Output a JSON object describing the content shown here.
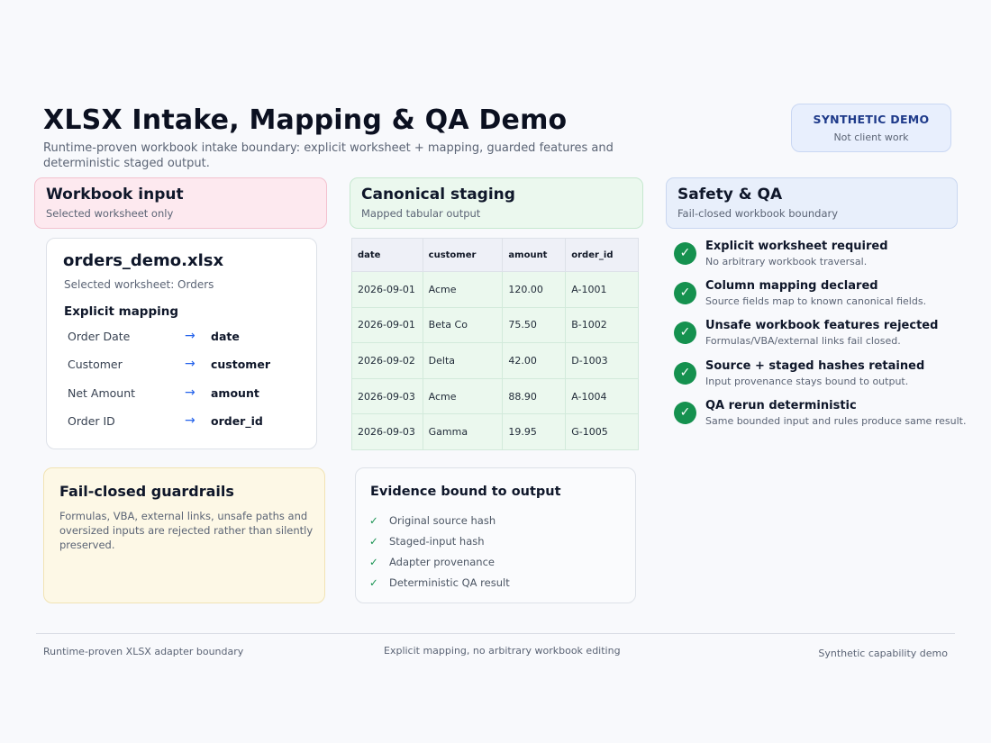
{
  "header": {
    "title": "XLSX Intake, Mapping & QA Demo",
    "subtitle": "Runtime-proven workbook intake boundary: explicit worksheet + mapping, guarded features and deterministic staged output."
  },
  "badge": {
    "title": "SYNTHETIC DEMO",
    "subtitle": "Not client work"
  },
  "columns": {
    "input": {
      "heading": "Workbook input",
      "sub": "Selected worksheet only"
    },
    "staging": {
      "heading": "Canonical staging",
      "sub": "Mapped tabular output"
    },
    "safety": {
      "heading": "Safety & QA",
      "sub": "Fail-closed workbook boundary"
    }
  },
  "file": {
    "name": "orders_demo.xlsx",
    "worksheet": "Selected worksheet: Orders",
    "mapping_heading": "Explicit mapping",
    "arrow_icon": "→",
    "mappings": [
      {
        "source": "Order Date",
        "target": "date"
      },
      {
        "source": "Customer",
        "target": "customer"
      },
      {
        "source": "Net Amount",
        "target": "amount"
      },
      {
        "source": "Order ID",
        "target": "order_id"
      }
    ]
  },
  "table": {
    "headers": [
      "date",
      "customer",
      "amount",
      "order_id"
    ],
    "rows": [
      [
        "2026-09-01",
        "Acme",
        "120.00",
        "A-1001"
      ],
      [
        "2026-09-01",
        "Beta Co",
        "75.50",
        "B-1002"
      ],
      [
        "2026-09-02",
        "Delta",
        "42.00",
        "D-1003"
      ],
      [
        "2026-09-03",
        "Acme",
        "88.90",
        "A-1004"
      ],
      [
        "2026-09-03",
        "Gamma",
        "19.95",
        "G-1005"
      ]
    ]
  },
  "qa": {
    "check_icon": "✓",
    "items": [
      {
        "title": "Explicit worksheet required",
        "sub": "No arbitrary workbook traversal."
      },
      {
        "title": "Column mapping declared",
        "sub": "Source fields map to known canonical fields."
      },
      {
        "title": "Unsafe workbook features rejected",
        "sub": "Formulas/VBA/external links fail closed."
      },
      {
        "title": "Source + staged hashes retained",
        "sub": "Input provenance stays bound to output."
      },
      {
        "title": "QA rerun deterministic",
        "sub": "Same bounded input and rules produce same result."
      }
    ]
  },
  "guardrails": {
    "heading": "Fail-closed guardrails",
    "body": "Formulas, VBA, external links, unsafe paths and oversized inputs are rejected rather than silently preserved."
  },
  "evidence": {
    "heading": "Evidence bound to output",
    "check_icon": "✓",
    "items": [
      "Original source hash",
      "Staged-input hash",
      "Adapter provenance",
      "Deterministic QA result"
    ]
  },
  "footer": {
    "left": "Runtime-proven XLSX adapter boundary",
    "center": "Explicit mapping, no arbitrary workbook editing",
    "right": "Synthetic capability demo"
  },
  "colors": {
    "accent_blue": "#2563eb",
    "check_green": "#15914f",
    "navy": "#1e3a8a"
  }
}
